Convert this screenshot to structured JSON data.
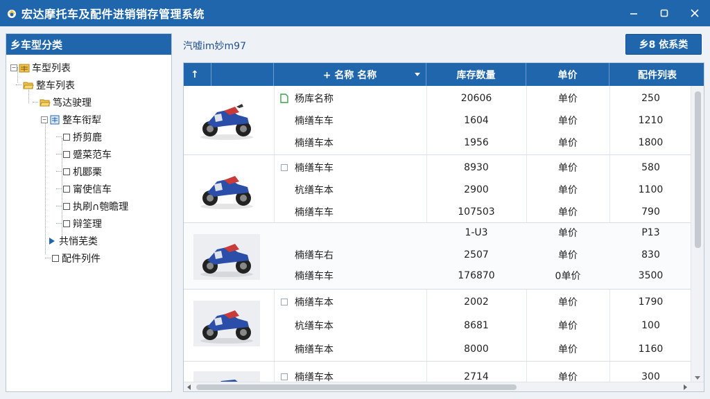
{
  "window": {
    "title": "宏达摩托车及配件进销销存管理系统",
    "controls": [
      "minimize-icon",
      "maximize-icon",
      "close-icon"
    ]
  },
  "colors": {
    "accent": "#1f66ad",
    "panel_border": "#b9c6d6"
  },
  "sidebar": {
    "header": "乡车型分类",
    "items": [
      {
        "label": "车型列表",
        "icon": "folder-grid-icon"
      },
      {
        "label": "整车列表",
        "icon": "folder-open-icon"
      },
      {
        "label": "笃达驶理",
        "icon": "folder-open-icon"
      },
      {
        "label": "整车衔犁",
        "icon": "document-grid-icon"
      },
      {
        "label": "挢剪鹿"
      },
      {
        "label": "蹙菜范车"
      },
      {
        "label": "机郾栗"
      },
      {
        "label": "甯使信车"
      },
      {
        "label": "执刷∩匏瞻理"
      },
      {
        "label": "辩筌理"
      },
      {
        "label": "共悄芜类"
      },
      {
        "label": "配件列件"
      }
    ]
  },
  "toolbar": {
    "info_text": "汽嘘im妙m97",
    "action_label": "乡8 依系类"
  },
  "table": {
    "sort_header": "↑",
    "columns": [
      "+ 名称 名称",
      "库存数量",
      "单价",
      "配件列表"
    ],
    "groups": [
      {
        "rows": [
          {
            "name": "杨库名称",
            "qty": "20606",
            "price": "单价",
            "parts": "250",
            "marker": "doc"
          },
          {
            "name": "楠缮车车",
            "qty": "1604",
            "price": "单价",
            "parts": "1210"
          },
          {
            "name": "楠缮车本",
            "qty": "1956",
            "price": "单价",
            "parts": "1800"
          }
        ]
      },
      {
        "rows": [
          {
            "name": "楠缮车车",
            "qty": "8930",
            "price": "单价",
            "parts": "580",
            "marker": "cb"
          },
          {
            "name": "杭缮车本",
            "qty": "2900",
            "price": "单价",
            "parts": "1100"
          },
          {
            "name": "楠缮车车",
            "qty": "107503",
            "price": "单价",
            "parts": "790"
          }
        ]
      },
      {
        "rows": [
          {
            "name": "",
            "qty": "1-U3",
            "price": "单价",
            "parts": "P13"
          },
          {
            "name": "楠缮车右",
            "qty": "2507",
            "price": "单价",
            "parts": "830"
          },
          {
            "name": "楠缮车车",
            "qty": "176870",
            "price": "0单价",
            "parts": "3500"
          }
        ]
      },
      {
        "rows": [
          {
            "name": "楠缮车本",
            "qty": "2002",
            "price": "单价",
            "parts": "1790",
            "marker": "cb"
          },
          {
            "name": "杭缮车本",
            "qty": "8681",
            "price": "单价",
            "parts": "100"
          },
          {
            "name": "楠缮车本",
            "qty": "8000",
            "price": "单价",
            "parts": "1160"
          }
        ]
      },
      {
        "rows": [
          {
            "name": "楠缮车本",
            "qty": "2714",
            "price": "单价",
            "parts": "300",
            "marker": "cb"
          }
        ]
      }
    ]
  }
}
